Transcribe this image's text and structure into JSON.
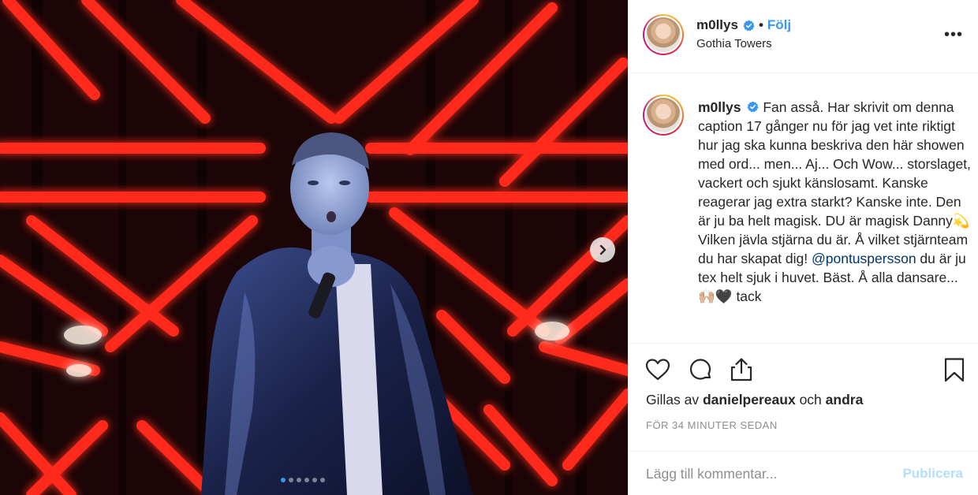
{
  "post": {
    "username": "m0llys",
    "follow_label": "Följ",
    "location": "Gothia Towers",
    "more_label": "•••"
  },
  "caption": {
    "username": "m0llys",
    "text_part1": "Fan asså. Har skrivit om denna caption 17 gånger nu för jag vet inte riktigt hur jag ska kunna beskriva den här showen med ord... men... Aj... Och Wow... storslaget, vackert och sjukt känslosamt. Kanske reagerar jag extra starkt? Kanske inte. Den är ju ba helt magisk. DU är magisk Danny💫 Vilken jävla stjärna du är. Å vilket stjärnteam du har skapat dig! ",
    "mention": "@pontuspersson",
    "text_part2": " du är ju tex helt sjuk i huvet. Bäst. Å alla dansare... 🙌🏼🖤 tack"
  },
  "likes": {
    "prefix": "Gillas av",
    "user": "danielpereaux",
    "joiner": "och",
    "others": "andra"
  },
  "timestamp": "FÖR 34 MINUTER SEDAN",
  "comment": {
    "placeholder": "Lägg till kommentar...",
    "publish_label": "Publicera"
  },
  "carousel": {
    "slide_count": 6,
    "active_index": 0
  },
  "icons": [
    "verified-badge-icon",
    "more-options-icon",
    "heart-icon",
    "comment-icon",
    "share-icon",
    "bookmark-icon",
    "chevron-right-icon"
  ],
  "colors": {
    "accent": "#3897f0",
    "mention": "#003569",
    "publish_disabled": "#b2dffc",
    "muted": "#8e8e8e",
    "neon": "#ff2a1a"
  }
}
